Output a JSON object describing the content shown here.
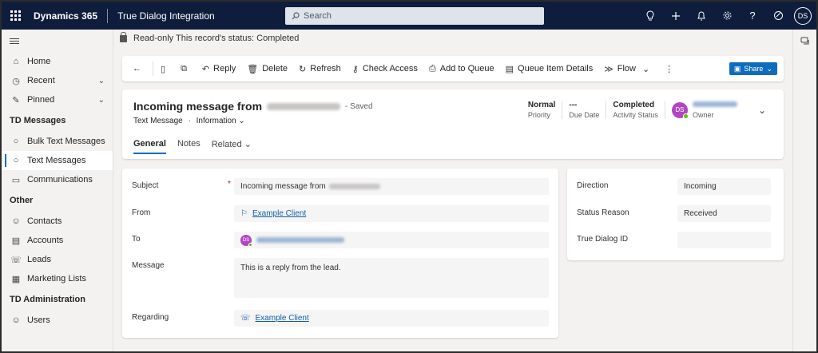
{
  "topbar": {
    "brand": "Dynamics 365",
    "app_name": "True Dialog Integration",
    "search_placeholder": "Search",
    "user_initials": "DS"
  },
  "readonly_notice": "Read-only This record's status: Completed",
  "sidebar": {
    "top_items": [
      {
        "label": "Home",
        "icon": "home-icon"
      },
      {
        "label": "Recent",
        "icon": "clock-icon"
      },
      {
        "label": "Pinned",
        "icon": "pin-icon"
      }
    ],
    "sections": [
      {
        "title": "TD Messages",
        "items": [
          "Bulk Text Messages",
          "Text Messages",
          "Communications"
        ]
      },
      {
        "title": "Other",
        "items": [
          "Contacts",
          "Accounts",
          "Leads",
          "Marketing Lists"
        ]
      },
      {
        "title": "TD Administration",
        "items": [
          "Users"
        ]
      }
    ],
    "active_item": "Text Messages"
  },
  "commands": {
    "reply": "Reply",
    "delete": "Delete",
    "refresh": "Refresh",
    "check_access": "Check Access",
    "add_to_queue": "Add to Queue",
    "queue_item_details": "Queue Item Details",
    "flow": "Flow",
    "share": "Share"
  },
  "record": {
    "title": "Incoming message from",
    "saved": "- Saved",
    "entity": "Text Message",
    "form": "Information",
    "priority_value": "Normal",
    "priority_label": "Priority",
    "due_date_value": "---",
    "due_date_label": "Due Date",
    "status_value": "Completed",
    "status_label": "Activity Status",
    "owner_initials": "DS",
    "owner_label": "Owner"
  },
  "tabs": [
    "General",
    "Notes",
    "Related"
  ],
  "form": {
    "subject_label": "Subject",
    "subject_value": "Incoming message from",
    "from_label": "From",
    "from_value": "Example Client",
    "to_label": "To",
    "to_initials": "DS",
    "message_label": "Message",
    "message_value": "This is a reply from the lead.",
    "regarding_label": "Regarding",
    "regarding_value": "Example Client"
  },
  "side": {
    "direction_label": "Direction",
    "direction_value": "Incoming",
    "status_reason_label": "Status Reason",
    "status_reason_value": "Received",
    "truedialog_id_label": "True Dialog ID",
    "truedialog_id_value": ""
  }
}
